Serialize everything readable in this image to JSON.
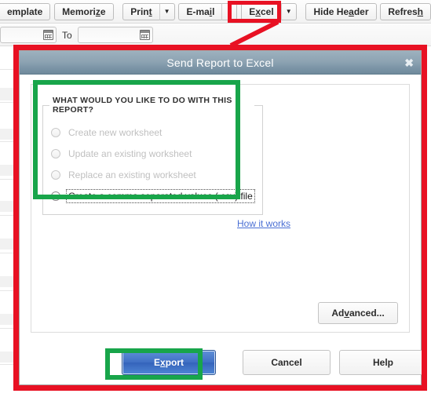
{
  "toolbar": {
    "buttons": [
      {
        "label": "emplate",
        "prefix": "",
        "accel": "",
        "suffix": "emplate",
        "split": false,
        "clipped": true
      },
      {
        "label": "Memorize",
        "prefix": "Memori",
        "accel": "z",
        "suffix": "e",
        "split": false,
        "clipped": false
      },
      {
        "label": "Print",
        "prefix": "Prin",
        "accel": "t",
        "suffix": "",
        "split": true,
        "clipped": false
      },
      {
        "label": "E-mail",
        "prefix": "E-ma",
        "accel": "i",
        "suffix": "l",
        "split": true,
        "clipped": false
      },
      {
        "label": "Excel",
        "prefix": "E",
        "accel": "x",
        "suffix": "cel",
        "split": true,
        "clipped": false
      },
      {
        "label": "Hide Header",
        "prefix": "Hide He",
        "accel": "a",
        "suffix": "der",
        "split": false,
        "clipped": false
      },
      {
        "label": "Refresh",
        "prefix": "Refres",
        "accel": "h",
        "suffix": "",
        "split": false,
        "clipped": false
      }
    ],
    "dropdown_glyph": "▼"
  },
  "date_row": {
    "from_value": "",
    "to_label": "To",
    "to_value": "",
    "calendar_icon": "calendar-icon"
  },
  "dialog": {
    "title": "Send Report to Excel",
    "close_glyph": "✖",
    "groupbox_legend": "WHAT WOULD YOU LIKE TO DO WITH THIS REPORT?",
    "options": [
      {
        "label": "Create new worksheet",
        "enabled": false,
        "selected": false
      },
      {
        "label": "Update an existing worksheet",
        "enabled": false,
        "selected": false
      },
      {
        "label": "Replace an existing worksheet",
        "enabled": false,
        "selected": false
      },
      {
        "label": "Create a comma separated values (.csv) file",
        "enabled": true,
        "selected": true
      }
    ],
    "how_it_works_link": "How it works",
    "advanced_button": {
      "prefix": "Ad",
      "accel": "v",
      "suffix": "anced..."
    },
    "footer_buttons": {
      "export": {
        "prefix": "E",
        "accel": "x",
        "suffix": "port"
      },
      "cancel": "Cancel",
      "help": "Help"
    }
  },
  "annotations": {
    "red_color": "#e81123",
    "green_color": "#18a54a",
    "highlighted_toolbar_button": "Excel",
    "highlighted_option_group": "WHAT WOULD YOU LIKE TO DO WITH THIS REPORT?",
    "highlighted_action_button": "Export"
  },
  "colors": {
    "title_gradient_top": "#9db1be",
    "title_gradient_bottom": "#6f8a9c",
    "export_blue": "#3f6fc4",
    "link_blue": "#4a6fd4",
    "disabled_text": "#c0c0c0"
  }
}
